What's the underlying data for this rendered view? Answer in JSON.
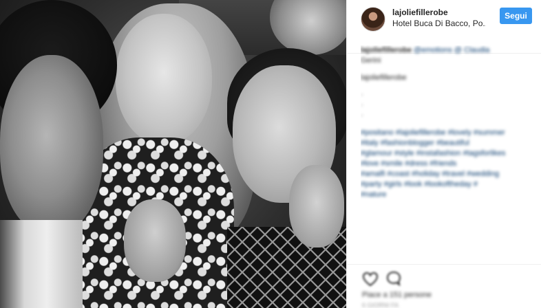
{
  "post": {
    "username": "lajoliefillerobe",
    "location": "Hotel Buca Di Bacco, Po...",
    "follow_label": "Segui"
  },
  "caption": {
    "line1_user": "lajoliefillerobe",
    "line1_rest": "@emotions @ Claudia",
    "line2": "Gerini",
    "line3": "lajoliefillerobe",
    "hashtag_lines": [
      "#positano #lajoliefillerobe #lovely #summer",
      "#italy #fashionblogger #beautiful",
      "#glamour #style #instafashion #tagsforlikes",
      "#love #smile #dress #friends",
      "#amalfi #coast #holiday #travel #wedding",
      "#party #girls #look #lookoftheday #",
      "#nature"
    ]
  },
  "footer": {
    "likes": "Piace a 151 persone",
    "timestamp": "6 GIORNI FA"
  },
  "colors": {
    "follow_button": "#3897f0",
    "hashtag": "#003569",
    "text": "#262626",
    "divider": "#efefef"
  },
  "icons": [
    "heart-icon",
    "comment-icon"
  ]
}
